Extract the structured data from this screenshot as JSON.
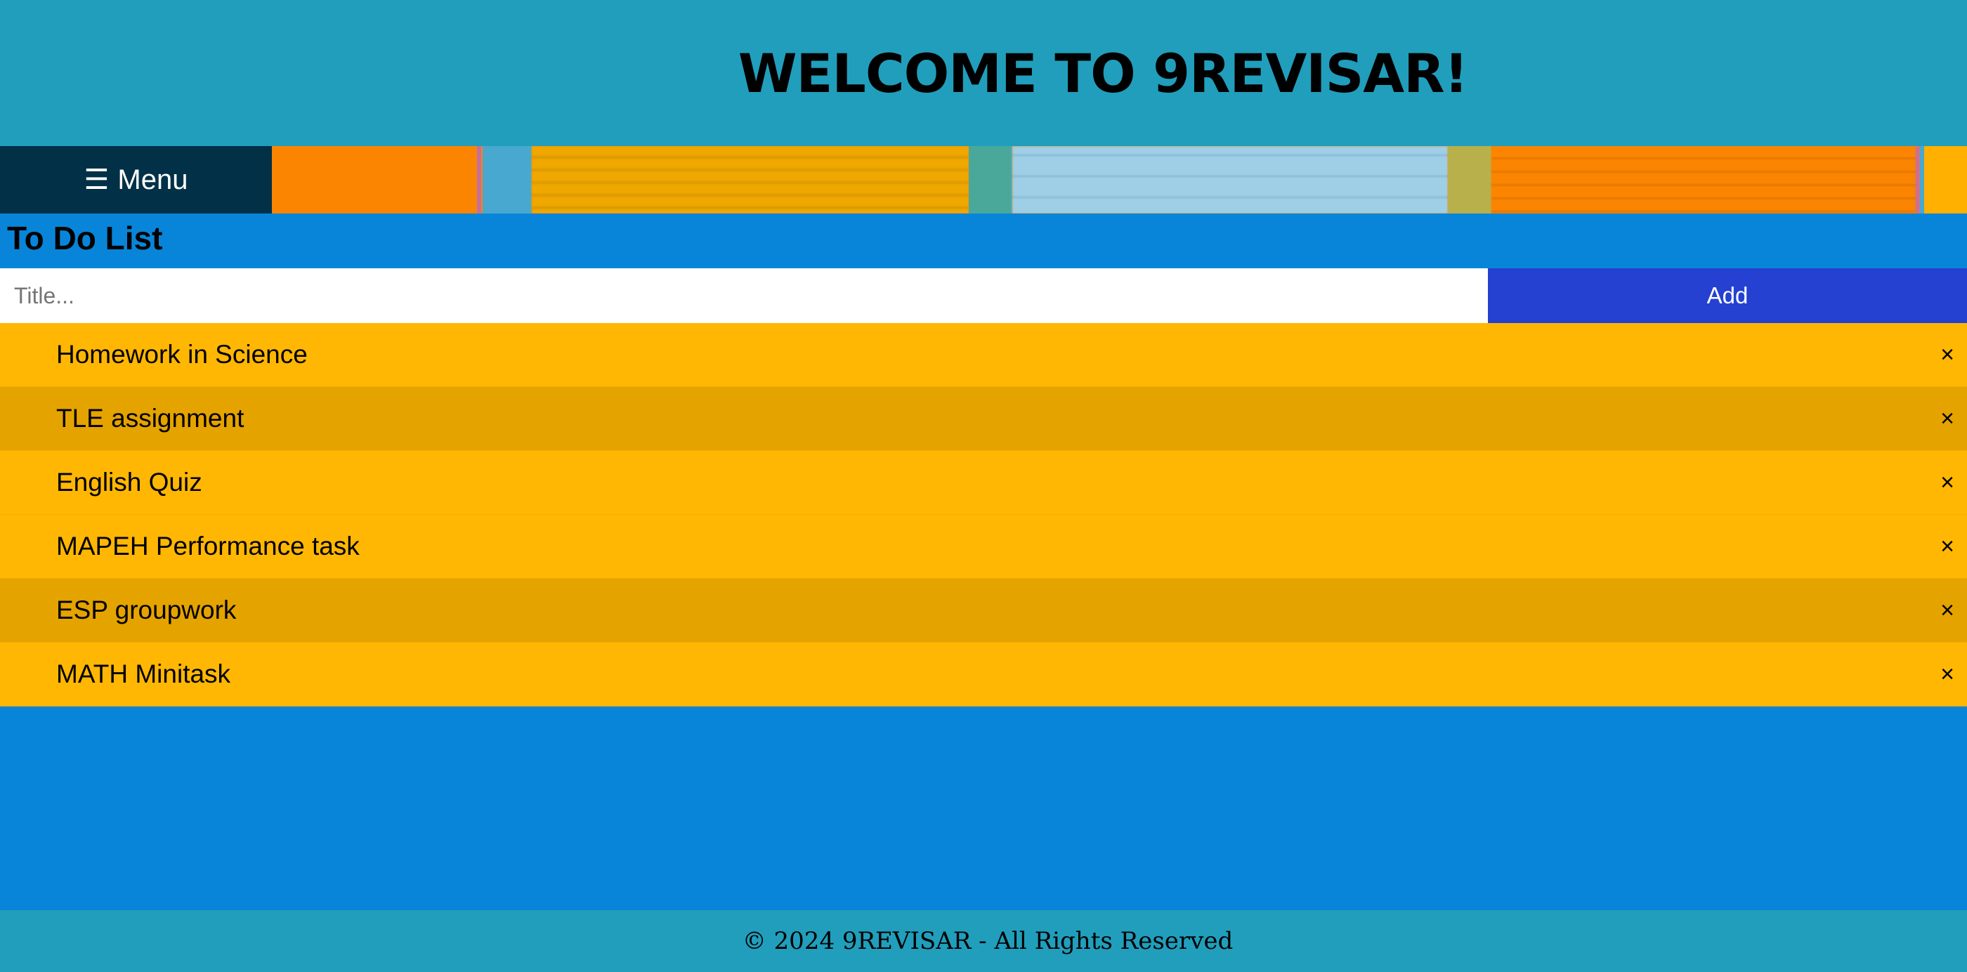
{
  "header": {
    "title": "WELCOME TO 9REVISAR!"
  },
  "nav": {
    "menu_icon": "☰",
    "menu_label": "Menu"
  },
  "todo": {
    "heading": "To Do List",
    "input_placeholder": "Title...",
    "input_value": "",
    "add_label": "Add",
    "close_glyph": "×",
    "items": [
      {
        "label": "Homework in Science",
        "highlighted": false
      },
      {
        "label": "TLE assignment",
        "highlighted": true
      },
      {
        "label": "English Quiz",
        "highlighted": false
      },
      {
        "label": "MAPEH Performance task",
        "highlighted": false
      },
      {
        "label": "ESP groupwork",
        "highlighted": true
      },
      {
        "label": "MATH Minitask",
        "highlighted": false
      }
    ]
  },
  "footer": {
    "text": "© 2024 9REVISAR - All Rights Reserved"
  },
  "colors": {
    "header_bg": "#219ebc",
    "menu_bg": "#023047",
    "body_bg": "#0885d8",
    "add_button_bg": "#2441d1",
    "item_bg": "#ffb703",
    "item_alt_bg": "#e5a300"
  }
}
